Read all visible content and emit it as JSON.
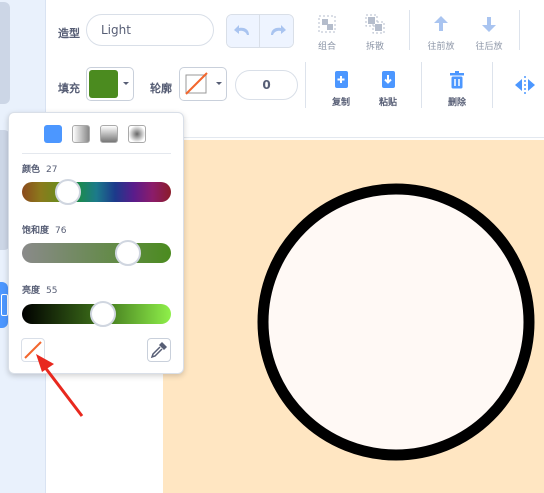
{
  "costume": {
    "label": "造型",
    "name": "Light"
  },
  "fill": {
    "label": "填充",
    "color": "#4b8b1f"
  },
  "outline": {
    "label": "轮廓",
    "width": "0"
  },
  "tools": {
    "group": "组合",
    "ungroup": "拆散",
    "forward": "往前放",
    "backward": "往后放",
    "copy": "复制",
    "paste": "粘贴",
    "delete": "删除"
  },
  "color_picker": {
    "hue": {
      "label": "颜色",
      "value": "27",
      "level": 27
    },
    "saturation": {
      "label": "饱和度",
      "value": "76",
      "level": 76
    },
    "brightness": {
      "label": "亮度",
      "value": "55",
      "level": 55
    }
  },
  "colors": {
    "accent": "#4c97ff",
    "canvas_bg": "#ffe6c2",
    "circle_fill": "#fff9f5",
    "circle_stroke": "#000000",
    "arrow": "#e8281e"
  }
}
